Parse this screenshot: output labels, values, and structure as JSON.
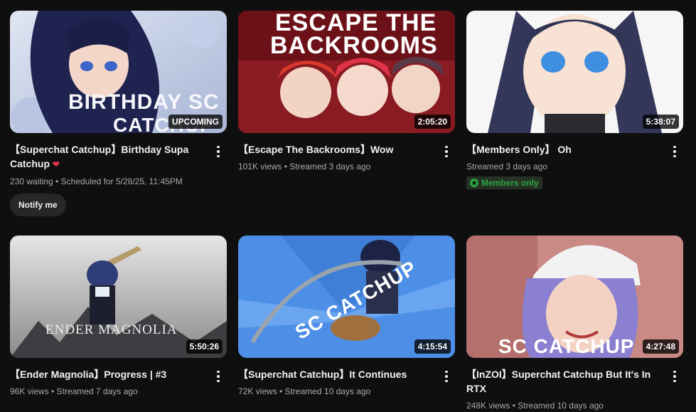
{
  "videos": [
    {
      "title": "【Superchat Catchup】Birthday Supa Catchup",
      "title_emoji": "❤",
      "overlay_text": "BIRTHDAY SC",
      "overlay_text_2": "CATCHUP",
      "badge": "UPCOMING",
      "meta": "230 waiting • Scheduled for 5/28/25, 11:45PM",
      "button": "Notify me"
    },
    {
      "title": "【Escape The Backrooms】Wow",
      "overlay_text": "ESCAPE THE",
      "overlay_text_2": "BACKROOMS",
      "badge": "2:05:20",
      "meta": "101K views • Streamed 3 days ago"
    },
    {
      "title": "【Members Only】 Oh",
      "badge": "5:38:07",
      "meta": "Streamed 3 days ago",
      "members_badge": "Members only"
    },
    {
      "title": "【Ender Magnolia】Progress | #3",
      "overlay_text": "ENDER MAGNOLIA",
      "badge": "5:50:26",
      "meta": "96K views • Streamed 7 days ago"
    },
    {
      "title": "【Superchat Catchup】It Continues",
      "overlay_text": "SC CATCHUP",
      "badge": "4:15:54",
      "meta": "72K views • Streamed 10 days ago"
    },
    {
      "title": "【InZOI】Superchat Catchup But It's In RTX",
      "overlay_text": "SC CATCHUP",
      "badge": "4:27:48",
      "meta": "248K views • Streamed 10 days ago"
    }
  ],
  "colors": {
    "background": "#0f0f0f",
    "members_green": "#2ba640"
  }
}
